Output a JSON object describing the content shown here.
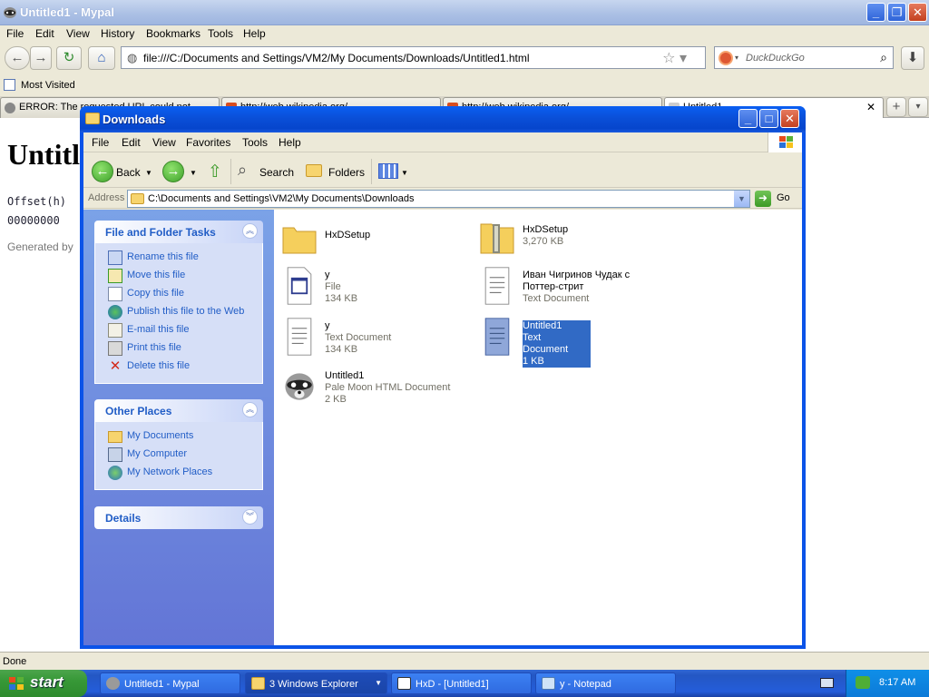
{
  "browser": {
    "title": "Untitled1 - Mypal",
    "menu": [
      "File",
      "Edit",
      "View",
      "History",
      "Bookmarks",
      "Tools",
      "Help"
    ],
    "url": "file:///C:/Documents and Settings/VM2/My Documents/Downloads/Untitled1.html",
    "search_placeholder": "DuckDuckGo",
    "bookmarks_item": "Most Visited",
    "tabs": [
      {
        "label": "ERROR: The requested URL could not..."
      },
      {
        "label": "http://web.wikipedia.org/..."
      },
      {
        "label": "http://web.wikipedia.org/..."
      },
      {
        "label": "Untitled1"
      }
    ],
    "page": {
      "heading": "Untitl",
      "offset_label": "Offset(h)",
      "offset_value": "00000000",
      "generated": "Generated by"
    },
    "status": "Done"
  },
  "explorer": {
    "title": "Downloads",
    "menu": [
      "File",
      "Edit",
      "View",
      "Favorites",
      "Tools",
      "Help"
    ],
    "toolbar": {
      "back": "Back",
      "search": "Search",
      "folders": "Folders"
    },
    "address_label": "Address",
    "address": "C:\\Documents and Settings\\VM2\\My Documents\\Downloads",
    "go": "Go",
    "tasks": {
      "title": "File and Folder Tasks",
      "items": [
        "Rename this file",
        "Move this file",
        "Copy this file",
        "Publish this file to the Web",
        "E-mail this file",
        "Print this file",
        "Delete this file"
      ]
    },
    "places": {
      "title": "Other Places",
      "items": [
        "My Documents",
        "My Computer",
        "My Network Places"
      ]
    },
    "details": {
      "title": "Details"
    },
    "files": [
      {
        "name": "HxDSetup",
        "type": "",
        "size": ""
      },
      {
        "name": "HxDSetup",
        "type": "",
        "size": "3,270 KB"
      },
      {
        "name": "y",
        "type": "File",
        "size": "134 KB"
      },
      {
        "name": "Иван Чигринов Чудак с",
        "name2": "Поттер-стрит",
        "type": "Text Document",
        "size": ""
      },
      {
        "name": "y",
        "type": "Text Document",
        "size": "134 KB"
      },
      {
        "name": "Untitled1",
        "type": "Text Document",
        "size": "1 KB"
      },
      {
        "name": "Untitled1",
        "type": "Pale Moon HTML Document",
        "size": "2 KB"
      }
    ]
  },
  "taskbar": {
    "start": "start",
    "buttons": [
      "Untitled1 - Mypal",
      "3 Windows Explorer",
      "HxD - [Untitled1]",
      "y - Notepad"
    ],
    "clock": "8:17 AM"
  }
}
